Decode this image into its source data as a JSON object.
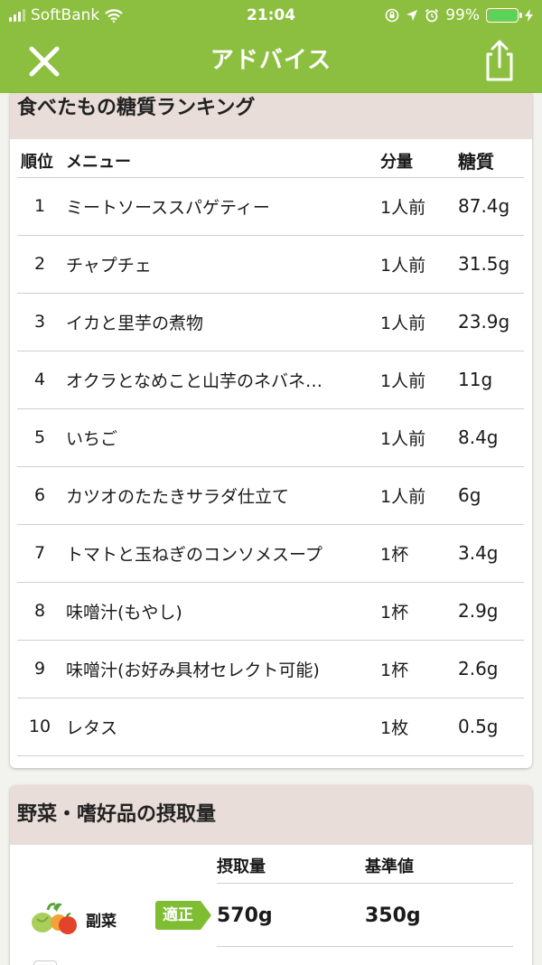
{
  "status_bar": {
    "carrier": "SoftBank",
    "time": "21:04",
    "battery": "99%"
  },
  "nav": {
    "title": "アドバイス",
    "close_icon": "close-x-icon",
    "share_icon": "share-icon"
  },
  "ranking": {
    "title": "食べたもの糖質ランキング",
    "headers": {
      "rank": "順位",
      "menu": "メニュー",
      "amount": "分量",
      "carbs": "糖質"
    },
    "rows": [
      {
        "rank": "1",
        "menu": "ミートソーススパゲティー",
        "amount": "1人前",
        "carbs": "87.4g"
      },
      {
        "rank": "2",
        "menu": "チャプチェ",
        "amount": "1人前",
        "carbs": "31.5g"
      },
      {
        "rank": "3",
        "menu": "イカと里芋の煮物",
        "amount": "1人前",
        "carbs": "23.9g"
      },
      {
        "rank": "4",
        "menu": "オクラとなめこと山芋のネバネ…",
        "amount": "1人前",
        "carbs": "11g"
      },
      {
        "rank": "5",
        "menu": "いちご",
        "amount": "1人前",
        "carbs": "8.4g"
      },
      {
        "rank": "6",
        "menu": "カツオのたたきサラダ仕立て",
        "amount": "1人前",
        "carbs": "6g"
      },
      {
        "rank": "7",
        "menu": "トマトと玉ねぎのコンソメスープ",
        "amount": "1杯",
        "carbs": "3.4g"
      },
      {
        "rank": "8",
        "menu": "味噌汁(もやし)",
        "amount": "1杯",
        "carbs": "2.9g"
      },
      {
        "rank": "9",
        "menu": "味噌汁(お好み具材セレクト可能)",
        "amount": "1杯",
        "carbs": "2.6g"
      },
      {
        "rank": "10",
        "menu": "レタス",
        "amount": "1枚",
        "carbs": "0.5g"
      }
    ]
  },
  "intake": {
    "title": "野菜・嗜好品の摂取量",
    "headers": {
      "intake": "摂取量",
      "standard": "基準値"
    },
    "item": {
      "label": "副菜",
      "badge": "適正",
      "intake": "570g",
      "standard": "350g",
      "icon": "vegetables-icon"
    }
  },
  "colors": {
    "accent_green": "#8cbf3f",
    "badge_green": "#7fbd32",
    "section_header_bg": "#e8ddd8"
  }
}
